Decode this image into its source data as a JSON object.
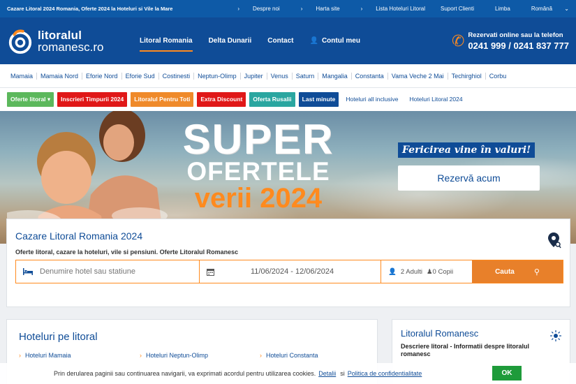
{
  "topbar": {
    "tagline": "Cazare Litoral 2024 Romania, Oferte 2024 la Hoteluri si Vile la Mare",
    "links": [
      "Despre noi",
      "Harta site",
      "Lista Hoteluri Litoral"
    ],
    "support": "Suport Clienti",
    "language_label": "Limba",
    "language_value": "Română"
  },
  "header": {
    "logo_line1": "litoralul",
    "logo_line2": "romanesc.ro",
    "nav": [
      "Litoral Romania",
      "Delta Dunarii",
      "Contact"
    ],
    "account": "Contul meu",
    "phone_label": "Rezervati online sau la telefon",
    "phone_numbers": "0241 999 / 0241 837 777"
  },
  "stations": [
    "Mamaia",
    "Mamaia Nord",
    "Eforie Nord",
    "Eforie Sud",
    "Costinesti",
    "Neptun-Olimp",
    "Jupiter",
    "Venus",
    "Saturn",
    "Mangalia",
    "Constanta",
    "Vama Veche 2 Mai",
    "Techirghiol",
    "Corbu"
  ],
  "offers": [
    {
      "label": "Oferte litoral ▾",
      "color": "#5cb85c"
    },
    {
      "label": "Inscrieri Timpurii 2024",
      "color": "#e01818"
    },
    {
      "label": "Litoralul Pentru Toti",
      "color": "#ef8a2a"
    },
    {
      "label": "Extra Discount",
      "color": "#e01818"
    },
    {
      "label": "Oferta Rusalii",
      "color": "#2aa6a0"
    },
    {
      "label": "Last minute",
      "color": "#0f4c97"
    }
  ],
  "offer_links": [
    "Hoteluri all inclusive",
    "Hoteluri Litoral 2024"
  ],
  "hero": {
    "line1": "SUPER",
    "line2": "OFERTELE",
    "line3": "verii 2024",
    "slogan": "Fericirea vine în valuri!",
    "button": "Rezervă acum"
  },
  "search": {
    "title": "Cazare Litoral Romania 2024",
    "subtitle": "Oferte litoral, cazare la hoteluri, vile si pensiuni. Oferte Litoralul Romanesc",
    "hotel_placeholder": "Denumire hotel sau statiune",
    "dates": "11/06/2024 - 12/06/2024",
    "adults": "2 Adulti",
    "children": "0 Copii",
    "button": "Cauta"
  },
  "hotels_card": {
    "title": "Hoteluri pe litoral",
    "links": [
      "Hoteluri Mamaia",
      "Hoteluri Neptun-Olimp",
      "Hoteluri Constanta"
    ]
  },
  "info_card": {
    "title": "Litoralul Romanesc",
    "description": "Descriere litoral - Informatii despre litoralul romanesc"
  },
  "cookie": {
    "text": "Prin derularea paginii sau continuarea navigarii, va exprimati acordul pentru utilizarea cookies.",
    "details": "Detalii",
    "and": "si",
    "privacy": "Politica de confidentialitate",
    "ok": "OK"
  },
  "colors": {
    "brand_blue": "#0f4c97",
    "topbar_blue": "#0e5aa7",
    "accent_orange": "#ff8a1e",
    "ok_green": "#1e9b3a"
  }
}
